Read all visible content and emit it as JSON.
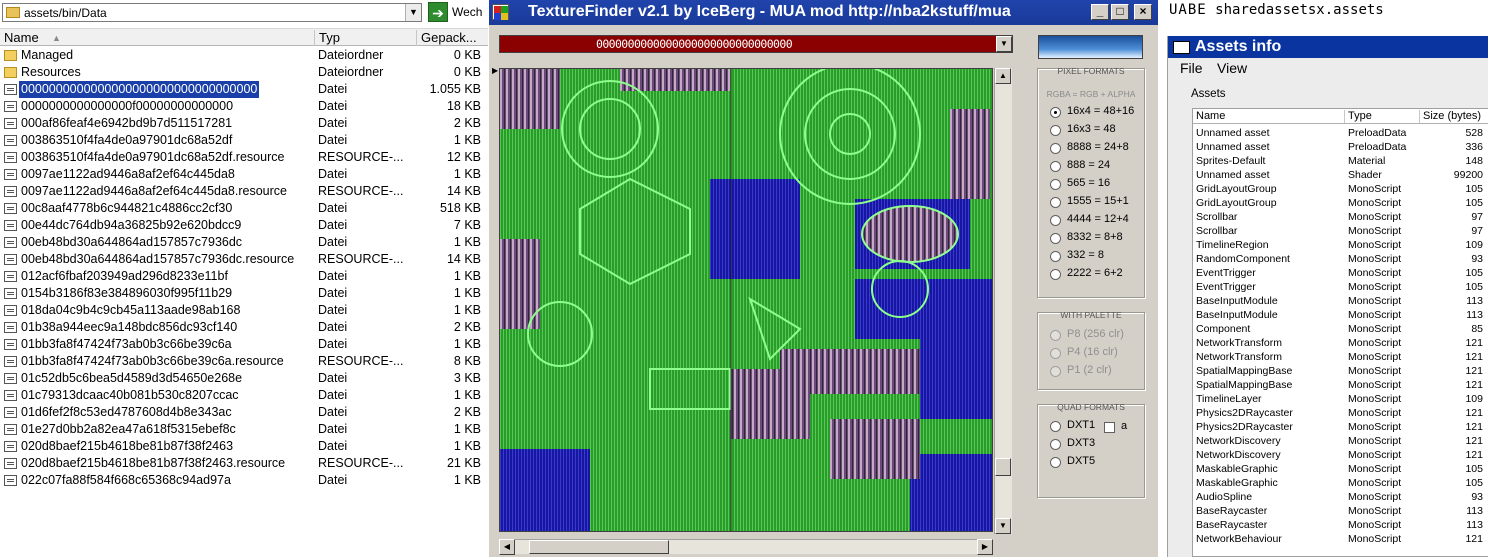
{
  "explorer": {
    "address": "assets/bin/Data",
    "go_label": "Wech",
    "columns": {
      "name": "Name",
      "type": "Typ",
      "size": "Gepack..."
    },
    "rows": [
      {
        "name": "Managed",
        "type": "Dateiordner",
        "size": "0 KB",
        "icon": "folder-icon"
      },
      {
        "name": "Resources",
        "type": "Dateiordner",
        "size": "0 KB",
        "icon": "folder-icon"
      },
      {
        "name": "0000000000000000000000000000000000",
        "type": "Datei",
        "size": "1.055 KB",
        "icon": "file-icon",
        "selected": true
      },
      {
        "name": "0000000000000000f00000000000000",
        "type": "Datei",
        "size": "18 KB",
        "icon": "file-icon"
      },
      {
        "name": "000af86feaf4e6942bd9b7d511517281",
        "type": "Datei",
        "size": "2 KB",
        "icon": "file-icon"
      },
      {
        "name": "003863510f4fa4de0a97901dc68a52df",
        "type": "Datei",
        "size": "1 KB",
        "icon": "file-icon"
      },
      {
        "name": "003863510f4fa4de0a97901dc68a52df.resource",
        "type": "RESOURCE-...",
        "size": "12 KB",
        "icon": "file-icon"
      },
      {
        "name": "0097ae1122ad9446a8af2ef64c445da8",
        "type": "Datei",
        "size": "1 KB",
        "icon": "file-icon"
      },
      {
        "name": "0097ae1122ad9446a8af2ef64c445da8.resource",
        "type": "RESOURCE-...",
        "size": "14 KB",
        "icon": "file-icon"
      },
      {
        "name": "00c8aaf4778b6c944821c4886cc2cf30",
        "type": "Datei",
        "size": "518 KB",
        "icon": "file-icon"
      },
      {
        "name": "00e44dc764db94a36825b92e620bdcc9",
        "type": "Datei",
        "size": "7 KB",
        "icon": "file-icon"
      },
      {
        "name": "00eb48bd30a644864ad157857c7936dc",
        "type": "Datei",
        "size": "1 KB",
        "icon": "file-icon"
      },
      {
        "name": "00eb48bd30a644864ad157857c7936dc.resource",
        "type": "RESOURCE-...",
        "size": "14 KB",
        "icon": "file-icon"
      },
      {
        "name": "012acf6fbaf203949ad296d8233e11bf",
        "type": "Datei",
        "size": "1 KB",
        "icon": "file-icon"
      },
      {
        "name": "0154b3186f83e384896030f995f11b29",
        "type": "Datei",
        "size": "1 KB",
        "icon": "file-icon"
      },
      {
        "name": "018da04c9b4c9cb45a113aade98ab168",
        "type": "Datei",
        "size": "1 KB",
        "icon": "file-icon"
      },
      {
        "name": "01b38a944eec9a148bdc856dc93cf140",
        "type": "Datei",
        "size": "2 KB",
        "icon": "file-icon"
      },
      {
        "name": "01bb3fa8f47424f73ab0b3c66be39c6a",
        "type": "Datei",
        "size": "1 KB",
        "icon": "file-icon"
      },
      {
        "name": "01bb3fa8f47424f73ab0b3c66be39c6a.resource",
        "type": "RESOURCE-...",
        "size": "8 KB",
        "icon": "file-icon"
      },
      {
        "name": "01c52db5c6bea5d4589d3d54650e268e",
        "type": "Datei",
        "size": "3 KB",
        "icon": "file-icon"
      },
      {
        "name": "01c79313dcaac40b081b530c8207ccac",
        "type": "Datei",
        "size": "1 KB",
        "icon": "file-icon"
      },
      {
        "name": "01d6fef2f8c53ed4787608d4b8e343ac",
        "type": "Datei",
        "size": "2 KB",
        "icon": "file-icon"
      },
      {
        "name": "01e27d0bb2a82ea47a618f5315ebef8c",
        "type": "Datei",
        "size": "1 KB",
        "icon": "file-icon"
      },
      {
        "name": "020d8baef215b4618be81b87f38f2463",
        "type": "Datei",
        "size": "1 KB",
        "icon": "file-icon"
      },
      {
        "name": "020d8baef215b4618be81b87f38f2463.resource",
        "type": "RESOURCE-...",
        "size": "21 KB",
        "icon": "file-icon"
      },
      {
        "name": "022c07fa88f584f668c65368c94ad97a",
        "type": "Datei",
        "size": "1 KB",
        "icon": "file-icon"
      }
    ]
  },
  "texturefinder": {
    "title": "TextureFinder v2.1 by IceBerg - MUA mod http://nba2kstuff/mua",
    "combo_value": "0000000000000000000000000000000",
    "pixel_formats": {
      "group_label": "PIXEL FORMATS",
      "subtitle": "RGBA = RGB + ALPHA",
      "options": [
        "16x4 = 48+16",
        "16x3 = 48",
        "8888 = 24+8",
        "888 = 24",
        "565 = 16",
        "1555 = 15+1",
        "4444 = 12+4",
        "8332 = 8+8",
        "332 = 8",
        "2222 = 6+2"
      ],
      "selected": "16x4 = 48+16"
    },
    "palette": {
      "group_label": "WITH PALETTE",
      "options": [
        "P8 (256 clr)",
        "P4 (16 clr)",
        "P1 (2 clr)"
      ]
    },
    "quad": {
      "group_label": "QUAD FORMATS",
      "options": [
        "DXT1",
        "DXT3",
        "DXT5"
      ],
      "alpha_checkbox_label": "a"
    },
    "colors": {
      "title_bar": "#1a3a98",
      "combo_bg": "#8b0000",
      "preview_green": "#2c9e2c",
      "preview_blue": "#1a1aa8"
    }
  },
  "uabe": {
    "caption_app": "UABE",
    "caption_file": "sharedassetsx.assets",
    "window_title": "Assets info",
    "menu": [
      "File",
      "View"
    ],
    "section_label": "Assets",
    "columns": {
      "name": "Name",
      "type": "Type",
      "size": "Size (bytes)"
    },
    "rows": [
      {
        "name": "Unnamed asset",
        "type": "PreloadData",
        "size": "528"
      },
      {
        "name": "Unnamed asset",
        "type": "PreloadData",
        "size": "336"
      },
      {
        "name": "Sprites-Default",
        "type": "Material",
        "size": "148"
      },
      {
        "name": "Unnamed asset",
        "type": "Shader",
        "size": "99200"
      },
      {
        "name": "GridLayoutGroup",
        "type": "MonoScript",
        "size": "105"
      },
      {
        "name": "GridLayoutGroup",
        "type": "MonoScript",
        "size": "105"
      },
      {
        "name": "Scrollbar",
        "type": "MonoScript",
        "size": "97"
      },
      {
        "name": "Scrollbar",
        "type": "MonoScript",
        "size": "97"
      },
      {
        "name": "TimelineRegion",
        "type": "MonoScript",
        "size": "109"
      },
      {
        "name": "RandomComponent",
        "type": "MonoScript",
        "size": "93"
      },
      {
        "name": "EventTrigger",
        "type": "MonoScript",
        "size": "105"
      },
      {
        "name": "EventTrigger",
        "type": "MonoScript",
        "size": "105"
      },
      {
        "name": "BaseInputModule",
        "type": "MonoScript",
        "size": "113"
      },
      {
        "name": "BaseInputModule",
        "type": "MonoScript",
        "size": "113"
      },
      {
        "name": "Component",
        "type": "MonoScript",
        "size": "85"
      },
      {
        "name": "NetworkTransform",
        "type": "MonoScript",
        "size": "121"
      },
      {
        "name": "NetworkTransform",
        "type": "MonoScript",
        "size": "121"
      },
      {
        "name": "SpatialMappingBase",
        "type": "MonoScript",
        "size": "121"
      },
      {
        "name": "SpatialMappingBase",
        "type": "MonoScript",
        "size": "121"
      },
      {
        "name": "TimelineLayer",
        "type": "MonoScript",
        "size": "109"
      },
      {
        "name": "Physics2DRaycaster",
        "type": "MonoScript",
        "size": "121"
      },
      {
        "name": "Physics2DRaycaster",
        "type": "MonoScript",
        "size": "121"
      },
      {
        "name": "NetworkDiscovery",
        "type": "MonoScript",
        "size": "121"
      },
      {
        "name": "NetworkDiscovery",
        "type": "MonoScript",
        "size": "121"
      },
      {
        "name": "MaskableGraphic",
        "type": "MonoScript",
        "size": "105"
      },
      {
        "name": "MaskableGraphic",
        "type": "MonoScript",
        "size": "105"
      },
      {
        "name": "AudioSpline",
        "type": "MonoScript",
        "size": "93"
      },
      {
        "name": "BaseRaycaster",
        "type": "MonoScript",
        "size": "113"
      },
      {
        "name": "BaseRaycaster",
        "type": "MonoScript",
        "size": "113"
      },
      {
        "name": "NetworkBehaviour",
        "type": "MonoScript",
        "size": "121"
      }
    ]
  }
}
